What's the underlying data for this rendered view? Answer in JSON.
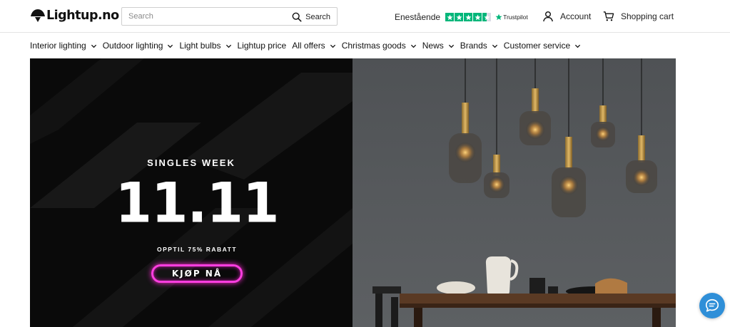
{
  "header": {
    "logo_text": "Lightup.no",
    "search": {
      "placeholder": "Search",
      "button_label": "Search",
      "icon": "search-icon"
    },
    "trustpilot": {
      "rating_text": "Enestående",
      "stars": 4.5,
      "brand": "Trustpilot",
      "color": "#00b67a"
    },
    "account_label": "Account",
    "cart_label": "Shopping cart"
  },
  "nav": {
    "items": [
      {
        "label": "Interior lighting",
        "dropdown": true
      },
      {
        "label": "Outdoor lighting",
        "dropdown": true
      },
      {
        "label": "Light bulbs",
        "dropdown": true
      },
      {
        "label": "Lightup price",
        "dropdown": false
      },
      {
        "label": "All offers",
        "dropdown": true
      },
      {
        "label": "Christmas goods",
        "dropdown": true
      },
      {
        "label": "News",
        "dropdown": true
      },
      {
        "label": "Brands",
        "dropdown": true
      },
      {
        "label": "Customer service",
        "dropdown": true
      }
    ]
  },
  "hero": {
    "eyebrow": "SINGLES WEEK",
    "headline": "11.11",
    "subline": "OPPTIL 75% RABATT",
    "cta_label": "KJØP NÅ",
    "cta_color": "#ff3ee0"
  },
  "chat": {
    "icon": "chat-bubble-icon",
    "color": "#2f8fd8"
  }
}
